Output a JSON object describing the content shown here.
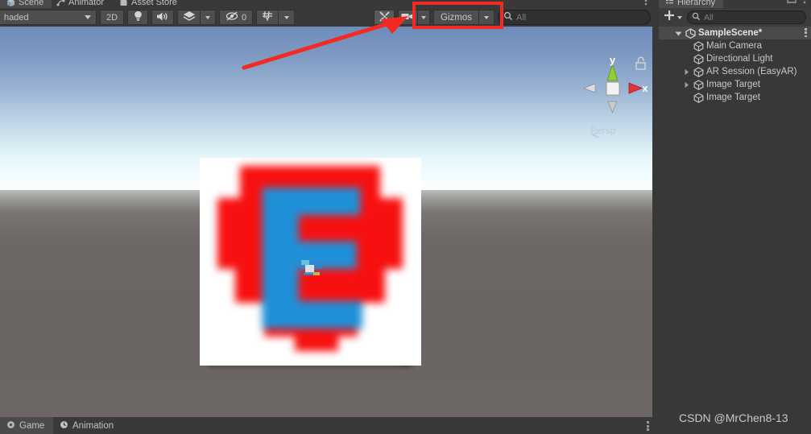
{
  "app": {
    "theme_bg": "#383838",
    "accent_red": "#f22a22"
  },
  "scene_panel": {
    "tabs": [
      {
        "label": "Scene",
        "icon": "scene-icon",
        "active": true
      },
      {
        "label": "Animator",
        "icon": "animator-icon",
        "active": false
      },
      {
        "label": "Asset Store",
        "icon": "asset-store-icon",
        "active": false
      }
    ],
    "toolbar": {
      "draw_mode": "haded",
      "draw_mode_full": "Shaded",
      "two_d_label": "2D",
      "lighting_icon": "lightbulb-icon",
      "audio_icon": "speaker-icon",
      "fx_icon": "effects-icon",
      "hidden_objects_icon": "eye-slash-icon",
      "hidden_objects_count": "0",
      "grid_icon": "grid-icon",
      "tools_icon": "tools-icon",
      "camera_icon": "camera-icon",
      "gizmos_label": "Gizmos",
      "search_placeholder": "All",
      "search_icon": "search-icon"
    },
    "view_gizmo": {
      "axis_y_label": "y",
      "axis_x_label": "x",
      "projection_label": "Persp",
      "lock_icon": "padlock-icon",
      "y_color": "#8ed135",
      "x_color": "#e23434",
      "z_color": "#bdbdbd"
    },
    "annotation": {
      "type": "red-arrow-and-box",
      "color": "#f22a22",
      "target": "Gizmos dropdown"
    },
    "image_target": {
      "label": "EasyAR logo image target",
      "letter": "E",
      "letter_color": "#1f90d8",
      "background_color": "#ffffff",
      "shape_color": "#f71010"
    },
    "options_icon": "kebab-menu-icon"
  },
  "bottom_tabs": [
    {
      "label": "Game",
      "icon": "game-icon",
      "active": true
    },
    {
      "label": "Animation",
      "icon": "animation-icon",
      "active": false
    }
  ],
  "hierarchy_panel": {
    "tab_label": "Hierarchy",
    "tab_icon": "hierarchy-icon",
    "add_label": "+",
    "search_placeholder": "All",
    "search_icon": "search-icon",
    "maximize_icon": "maximize-icon",
    "menu_icon": "kebab-menu-icon",
    "items": [
      {
        "label": "SampleScene*",
        "icon": "unity-scene-icon",
        "depth": 0,
        "expanded": true,
        "has_children": true,
        "is_scene": true
      },
      {
        "label": "Main Camera",
        "icon": "gameobject-icon",
        "depth": 1,
        "has_children": false
      },
      {
        "label": "Directional Light",
        "icon": "gameobject-icon",
        "depth": 1,
        "has_children": false
      },
      {
        "label": "AR Session (EasyAR)",
        "icon": "gameobject-icon",
        "depth": 1,
        "has_children": true,
        "expanded": false
      },
      {
        "label": "Image Target",
        "icon": "gameobject-icon",
        "depth": 1,
        "has_children": true,
        "expanded": false
      },
      {
        "label": "Image Target",
        "icon": "gameobject-icon",
        "depth": 1,
        "has_children": false
      }
    ]
  },
  "watermark": {
    "text": "CSDN @MrChen8-13"
  }
}
